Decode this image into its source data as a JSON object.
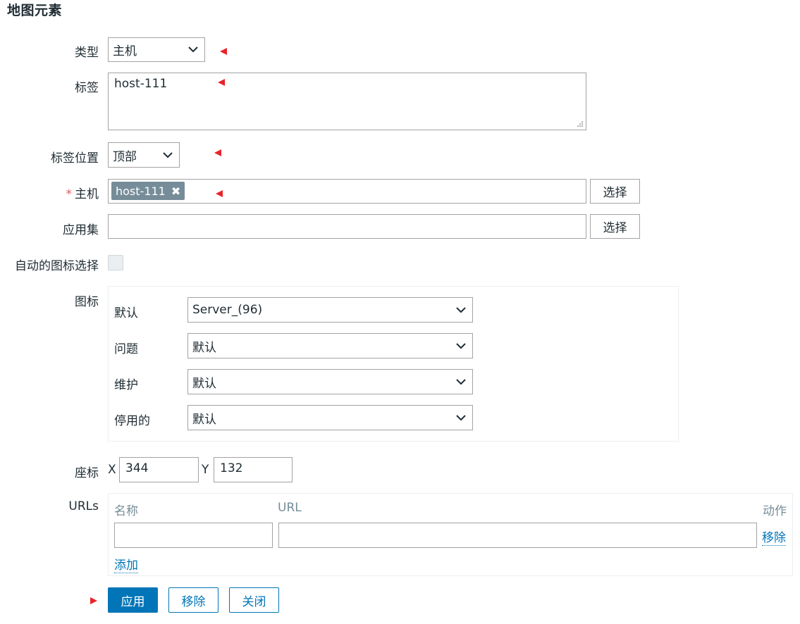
{
  "page": {
    "title": "地图元素"
  },
  "form": {
    "type": {
      "label": "类型",
      "value": "主机"
    },
    "label_field": {
      "label": "标签",
      "value": "host-111"
    },
    "label_position": {
      "label": "标签位置",
      "value": "顶部"
    },
    "host": {
      "label": "主机",
      "required_mark": "*",
      "tag": "host-111",
      "select_button": "选择"
    },
    "app_set": {
      "label": "应用集",
      "value": "",
      "select_button": "选择"
    },
    "auto_icon": {
      "label": "自动的图标选择",
      "checked": false
    },
    "icons": {
      "label": "图标",
      "rows": [
        {
          "label": "默认",
          "value": "Server_(96)"
        },
        {
          "label": "问题",
          "value": "默认"
        },
        {
          "label": "维护",
          "value": "默认"
        },
        {
          "label": "停用的",
          "value": "默认"
        }
      ]
    },
    "coords": {
      "label": "座标",
      "x_label": "X",
      "x": "344",
      "y_label": "Y",
      "y": "132"
    },
    "urls": {
      "label": "URLs",
      "col_name": "名称",
      "col_url": "URL",
      "col_action": "动作",
      "rows": [
        {
          "name": "",
          "url": "",
          "action": "移除"
        }
      ],
      "add": "添加"
    }
  },
  "actions": {
    "apply": "应用",
    "remove": "移除",
    "close": "关闭"
  },
  "colors": {
    "accent": "#0275b8",
    "marker": "#e8242b",
    "tag_bg": "#768d99"
  }
}
